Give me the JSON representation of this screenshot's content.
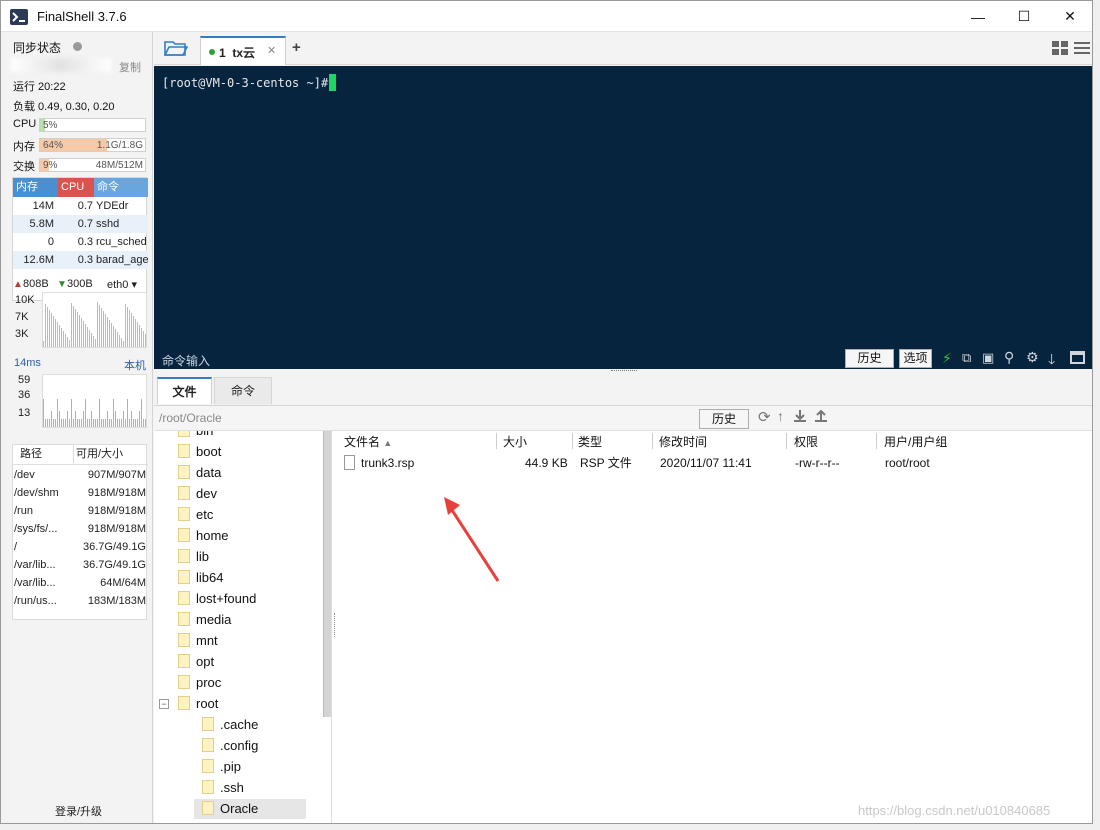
{
  "app": {
    "title": "FinalShell 3.7.6"
  },
  "window_controls": {
    "minimize": "—",
    "maximize": "☐",
    "close": "✕"
  },
  "left": {
    "sync_label": "同步状态",
    "copy_label": "复制",
    "uptime": "运行 20:22",
    "load": "负载 0.49, 0.30, 0.20",
    "cpu": {
      "label": "CPU",
      "text": "5%",
      "percent": 5
    },
    "mem": {
      "label": "内存",
      "text": "64%",
      "value": "1.1G/1.8G",
      "percent": 64
    },
    "swap": {
      "label": "交换",
      "text": "9%",
      "value": "48M/512M",
      "percent": 9
    },
    "proc_headers": [
      "内存",
      "CPU",
      "命令"
    ],
    "processes": [
      {
        "mem": "14M",
        "cpu": "0.7",
        "cmd": "YDEdr"
      },
      {
        "mem": "5.8M",
        "cpu": "0.7",
        "cmd": "sshd"
      },
      {
        "mem": "0",
        "cpu": "0.3",
        "cmd": "rcu_sched"
      },
      {
        "mem": "12.6M",
        "cpu": "0.3",
        "cmd": "barad_age"
      }
    ],
    "net": {
      "up": "808B",
      "down": "300B",
      "iface": "eth0",
      "ticks": [
        "10K",
        "7K",
        "3K"
      ]
    },
    "ping": {
      "latency": "14ms",
      "host": "本机",
      "ticks": [
        "59",
        "36",
        "13"
      ]
    },
    "fs_headers": [
      "路径",
      "可用/大小"
    ],
    "filesystems": [
      {
        "path": "/dev",
        "size": "907M/907M"
      },
      {
        "path": "/dev/shm",
        "size": "918M/918M"
      },
      {
        "path": "/run",
        "size": "918M/918M"
      },
      {
        "path": "/sys/fs/...",
        "size": "918M/918M"
      },
      {
        "path": "/",
        "size": "36.7G/49.1G"
      },
      {
        "path": "/var/lib...",
        "size": "36.7G/49.1G"
      },
      {
        "path": "/var/lib...",
        "size": "64M/64M"
      },
      {
        "path": "/run/us...",
        "size": "183M/183M"
      }
    ],
    "login": "登录/升级"
  },
  "tabs": [
    {
      "label": "1  tx云",
      "status": "connected"
    }
  ],
  "terminal": {
    "prompt": "[root@VM-0-3-centos ~]#"
  },
  "cmd": {
    "input_label": "命令输入",
    "history": "历史",
    "options": "选项"
  },
  "lower_tabs": [
    "文件",
    "命令"
  ],
  "path": {
    "value": "/root/Oracle",
    "history": "历史"
  },
  "tree": {
    "items": [
      "bin",
      "boot",
      "data",
      "dev",
      "etc",
      "home",
      "lib",
      "lib64",
      "lost+found",
      "media",
      "mnt",
      "opt",
      "proc",
      "root"
    ],
    "root_children": [
      ".cache",
      ".config",
      ".pip",
      ".ssh",
      "Oracle"
    ]
  },
  "file_columns": [
    "文件名",
    "大小",
    "类型",
    "修改时间",
    "权限",
    "用户/用户组"
  ],
  "files": [
    {
      "name": "trunk3.rsp",
      "size": "44.9 KB",
      "type": "RSP 文件",
      "mtime": "2020/11/07 11:41",
      "perm": "-rw-r--r--",
      "owner": "root/root"
    }
  ],
  "watermark": "https://blog.csdn.net/u010840685",
  "colors": {
    "terminal_bg": "#06243d",
    "cursor": "#1ed760",
    "mem_head": "#4a90d0",
    "cpu_head": "#d9534f",
    "cmd_head": "#6aa6de",
    "annotation_arrow": "#e8413b"
  }
}
